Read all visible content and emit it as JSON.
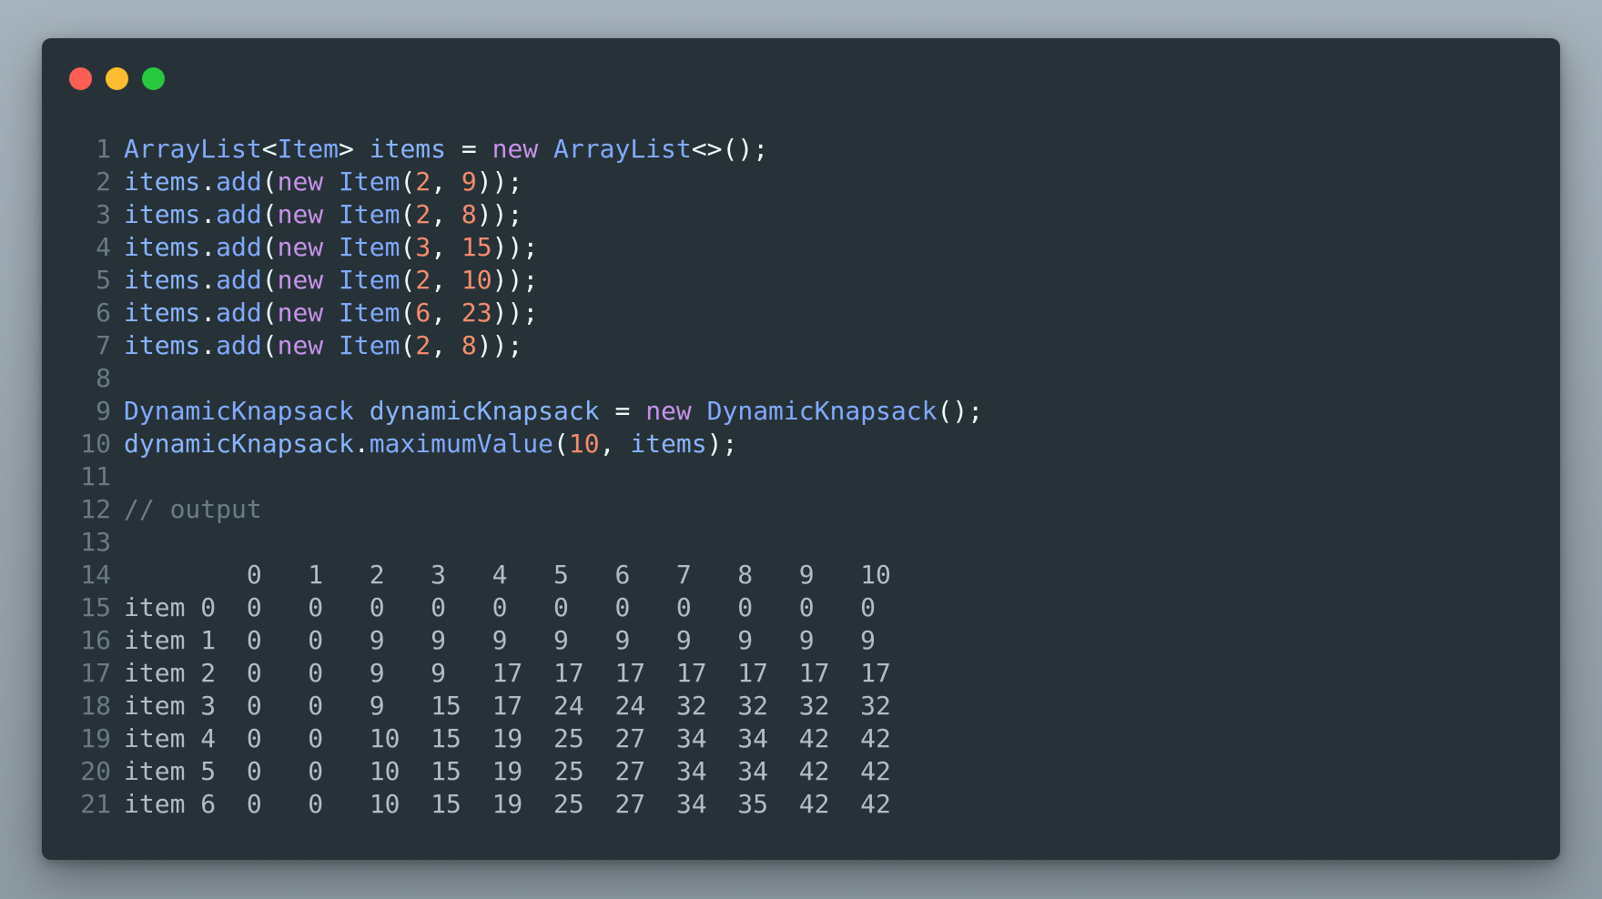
{
  "colors": {
    "window_bg": "#263238",
    "line_number": "#6a7a84",
    "class": "#82aaff",
    "variable": "#89b4ff",
    "keyword": "#c792ea",
    "number": "#f78c6c",
    "punctuation": "#eeffff",
    "comment": "#6b7d86",
    "output": "#b0bec5",
    "function": "#82aaff",
    "dot_close": "#ff5f57",
    "dot_minimize": "#febc2e",
    "dot_zoom": "#28c840"
  },
  "window": {
    "controls": [
      {
        "name": "close-dot",
        "color": "#ff5f57"
      },
      {
        "name": "minimize-dot",
        "color": "#febc2e"
      },
      {
        "name": "zoom-dot",
        "color": "#28c840"
      }
    ]
  },
  "code": {
    "lines": [
      {
        "n": "1",
        "tokens": [
          {
            "t": "ArrayList",
            "k": "cls"
          },
          {
            "t": "<",
            "k": "pun"
          },
          {
            "t": "Item",
            "k": "cls"
          },
          {
            "t": "> ",
            "k": "pun"
          },
          {
            "t": "items",
            "k": "var"
          },
          {
            "t": " = ",
            "k": "pun"
          },
          {
            "t": "new",
            "k": "kw"
          },
          {
            "t": " ",
            "k": "pun"
          },
          {
            "t": "ArrayList",
            "k": "cls"
          },
          {
            "t": "<>();",
            "k": "pun"
          }
        ]
      },
      {
        "n": "2",
        "tokens": [
          {
            "t": "items",
            "k": "var"
          },
          {
            "t": ".",
            "k": "pun"
          },
          {
            "t": "add",
            "k": "fn"
          },
          {
            "t": "(",
            "k": "pun"
          },
          {
            "t": "new",
            "k": "kw"
          },
          {
            "t": " ",
            "k": "pun"
          },
          {
            "t": "Item",
            "k": "cls"
          },
          {
            "t": "(",
            "k": "pun"
          },
          {
            "t": "2",
            "k": "num"
          },
          {
            "t": ", ",
            "k": "pun"
          },
          {
            "t": "9",
            "k": "num"
          },
          {
            "t": "));",
            "k": "pun"
          }
        ]
      },
      {
        "n": "3",
        "tokens": [
          {
            "t": "items",
            "k": "var"
          },
          {
            "t": ".",
            "k": "pun"
          },
          {
            "t": "add",
            "k": "fn"
          },
          {
            "t": "(",
            "k": "pun"
          },
          {
            "t": "new",
            "k": "kw"
          },
          {
            "t": " ",
            "k": "pun"
          },
          {
            "t": "Item",
            "k": "cls"
          },
          {
            "t": "(",
            "k": "pun"
          },
          {
            "t": "2",
            "k": "num"
          },
          {
            "t": ", ",
            "k": "pun"
          },
          {
            "t": "8",
            "k": "num"
          },
          {
            "t": "));",
            "k": "pun"
          }
        ]
      },
      {
        "n": "4",
        "tokens": [
          {
            "t": "items",
            "k": "var"
          },
          {
            "t": ".",
            "k": "pun"
          },
          {
            "t": "add",
            "k": "fn"
          },
          {
            "t": "(",
            "k": "pun"
          },
          {
            "t": "new",
            "k": "kw"
          },
          {
            "t": " ",
            "k": "pun"
          },
          {
            "t": "Item",
            "k": "cls"
          },
          {
            "t": "(",
            "k": "pun"
          },
          {
            "t": "3",
            "k": "num"
          },
          {
            "t": ", ",
            "k": "pun"
          },
          {
            "t": "15",
            "k": "num"
          },
          {
            "t": "));",
            "k": "pun"
          }
        ]
      },
      {
        "n": "5",
        "tokens": [
          {
            "t": "items",
            "k": "var"
          },
          {
            "t": ".",
            "k": "pun"
          },
          {
            "t": "add",
            "k": "fn"
          },
          {
            "t": "(",
            "k": "pun"
          },
          {
            "t": "new",
            "k": "kw"
          },
          {
            "t": " ",
            "k": "pun"
          },
          {
            "t": "Item",
            "k": "cls"
          },
          {
            "t": "(",
            "k": "pun"
          },
          {
            "t": "2",
            "k": "num"
          },
          {
            "t": ", ",
            "k": "pun"
          },
          {
            "t": "10",
            "k": "num"
          },
          {
            "t": "));",
            "k": "pun"
          }
        ]
      },
      {
        "n": "6",
        "tokens": [
          {
            "t": "items",
            "k": "var"
          },
          {
            "t": ".",
            "k": "pun"
          },
          {
            "t": "add",
            "k": "fn"
          },
          {
            "t": "(",
            "k": "pun"
          },
          {
            "t": "new",
            "k": "kw"
          },
          {
            "t": " ",
            "k": "pun"
          },
          {
            "t": "Item",
            "k": "cls"
          },
          {
            "t": "(",
            "k": "pun"
          },
          {
            "t": "6",
            "k": "num"
          },
          {
            "t": ", ",
            "k": "pun"
          },
          {
            "t": "23",
            "k": "num"
          },
          {
            "t": "));",
            "k": "pun"
          }
        ]
      },
      {
        "n": "7",
        "tokens": [
          {
            "t": "items",
            "k": "var"
          },
          {
            "t": ".",
            "k": "pun"
          },
          {
            "t": "add",
            "k": "fn"
          },
          {
            "t": "(",
            "k": "pun"
          },
          {
            "t": "new",
            "k": "kw"
          },
          {
            "t": " ",
            "k": "pun"
          },
          {
            "t": "Item",
            "k": "cls"
          },
          {
            "t": "(",
            "k": "pun"
          },
          {
            "t": "2",
            "k": "num"
          },
          {
            "t": ", ",
            "k": "pun"
          },
          {
            "t": "8",
            "k": "num"
          },
          {
            "t": "));",
            "k": "pun"
          }
        ]
      },
      {
        "n": "8",
        "tokens": []
      },
      {
        "n": "9",
        "tokens": [
          {
            "t": "DynamicKnapsack",
            "k": "cls"
          },
          {
            "t": " ",
            "k": "pun"
          },
          {
            "t": "dynamicKnapsack",
            "k": "var"
          },
          {
            "t": " = ",
            "k": "pun"
          },
          {
            "t": "new",
            "k": "kw"
          },
          {
            "t": " ",
            "k": "pun"
          },
          {
            "t": "DynamicKnapsack",
            "k": "cls"
          },
          {
            "t": "();",
            "k": "pun"
          }
        ]
      },
      {
        "n": "10",
        "tokens": [
          {
            "t": "dynamicKnapsack",
            "k": "var"
          },
          {
            "t": ".",
            "k": "pun"
          },
          {
            "t": "maximumValue",
            "k": "fn"
          },
          {
            "t": "(",
            "k": "pun"
          },
          {
            "t": "10",
            "k": "num"
          },
          {
            "t": ", ",
            "k": "pun"
          },
          {
            "t": "items",
            "k": "var"
          },
          {
            "t": ");",
            "k": "pun"
          }
        ]
      },
      {
        "n": "11",
        "tokens": []
      },
      {
        "n": "12",
        "tokens": [
          {
            "t": "// output",
            "k": "com"
          }
        ]
      },
      {
        "n": "13",
        "tokens": []
      },
      {
        "n": "14",
        "tokens": [
          {
            "t": "        0   1   2   3   4   5   6   7   8   9   10",
            "k": "out"
          }
        ]
      },
      {
        "n": "15",
        "tokens": [
          {
            "t": "item 0  0   0   0   0   0   0   0   0   0   0   0",
            "k": "out"
          }
        ]
      },
      {
        "n": "16",
        "tokens": [
          {
            "t": "item 1  0   0   9   9   9   9   9   9   9   9   9",
            "k": "out"
          }
        ]
      },
      {
        "n": "17",
        "tokens": [
          {
            "t": "item 2  0   0   9   9   17  17  17  17  17  17  17",
            "k": "out"
          }
        ]
      },
      {
        "n": "18",
        "tokens": [
          {
            "t": "item 3  0   0   9   15  17  24  24  32  32  32  32",
            "k": "out"
          }
        ]
      },
      {
        "n": "19",
        "tokens": [
          {
            "t": "item 4  0   0   10  15  19  25  27  34  34  42  42",
            "k": "out"
          }
        ]
      },
      {
        "n": "20",
        "tokens": [
          {
            "t": "item 5  0   0   10  15  19  25  27  34  34  42  42",
            "k": "out"
          }
        ]
      },
      {
        "n": "21",
        "tokens": [
          {
            "t": "item 6  0   0   10  15  19  25  27  34  35  42  42",
            "k": "out"
          }
        ]
      }
    ]
  }
}
